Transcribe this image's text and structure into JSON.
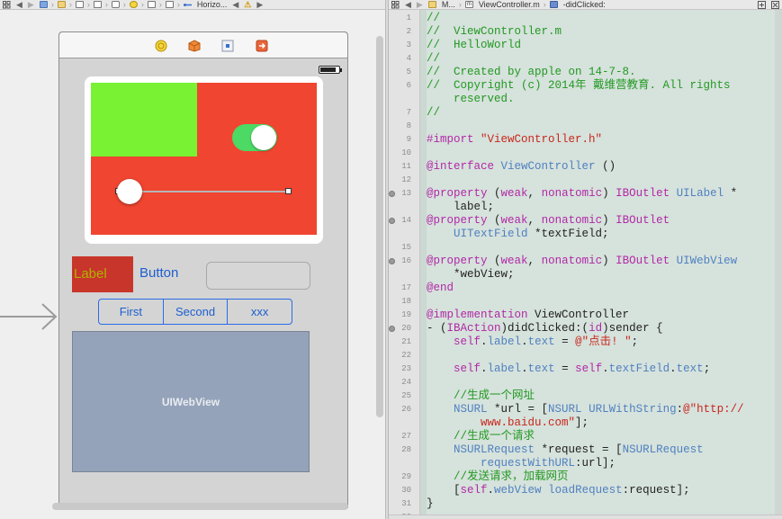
{
  "storyboard": {
    "jumpbar": {
      "nav_back": "◀",
      "nav_forward": "▶",
      "scene_label": "Horizo...",
      "warning_icon": "⚠"
    },
    "dock_icons": [
      "view-controller-icon",
      "first-responder-icon",
      "exit-icon",
      "unwind-icon"
    ],
    "label_text": "Label",
    "button_text": "Button",
    "textfield_value": "",
    "segments": [
      "First",
      "Second",
      "xxx"
    ],
    "webview_text": "UIWebView",
    "switch_on": true,
    "slider_value": 0,
    "colors": {
      "red_view": "#ef4531",
      "green_view": "#78f232",
      "switch_on": "#4cd964",
      "tint": "#1d5fcf",
      "webview": "#94a3b9"
    }
  },
  "editor": {
    "jumpbar": {
      "group": "M...",
      "file": "ViewController.m",
      "method": "-didClicked:",
      "warning_icon": "⚠"
    },
    "colors": {
      "background": "#d6e2dc",
      "comment": "#229922",
      "keyword": "#b128a6",
      "string": "#c8261c",
      "type": "#4f81c0"
    },
    "lines": [
      {
        "n": "1",
        "dot": false,
        "tokens": [
          [
            "c",
            "//"
          ]
        ]
      },
      {
        "n": "2",
        "dot": false,
        "tokens": [
          [
            "c",
            "//  ViewController.m"
          ]
        ]
      },
      {
        "n": "3",
        "dot": false,
        "tokens": [
          [
            "c",
            "//  HelloWorld"
          ]
        ]
      },
      {
        "n": "4",
        "dot": false,
        "tokens": [
          [
            "c",
            "//"
          ]
        ]
      },
      {
        "n": "5",
        "dot": false,
        "tokens": [
          [
            "c",
            "//  Created by apple on 14-7-8."
          ]
        ]
      },
      {
        "n": "6",
        "dot": false,
        "tokens": [
          [
            "c",
            "//  Copyright (c) 2014年 戴维营教育. All rights"
          ]
        ]
      },
      {
        "n": "",
        "dot": false,
        "tokens": [
          [
            "c",
            "    reserved."
          ]
        ]
      },
      {
        "n": "7",
        "dot": false,
        "tokens": [
          [
            "c",
            "//"
          ]
        ]
      },
      {
        "n": "8",
        "dot": false,
        "tokens": []
      },
      {
        "n": "9",
        "dot": false,
        "tokens": [
          [
            "k",
            "#import"
          ],
          [
            "p",
            " "
          ],
          [
            "s",
            "\"ViewController.h\""
          ]
        ]
      },
      {
        "n": "10",
        "dot": false,
        "tokens": []
      },
      {
        "n": "11",
        "dot": false,
        "tokens": [
          [
            "k",
            "@interface"
          ],
          [
            "p",
            " "
          ],
          [
            "t",
            "ViewController"
          ],
          [
            "p",
            " ()"
          ]
        ]
      },
      {
        "n": "12",
        "dot": false,
        "tokens": []
      },
      {
        "n": "13",
        "dot": true,
        "tokens": [
          [
            "k",
            "@property"
          ],
          [
            "p",
            " ("
          ],
          [
            "k",
            "weak"
          ],
          [
            "p",
            ", "
          ],
          [
            "k",
            "nonatomic"
          ],
          [
            "p",
            ") "
          ],
          [
            "k",
            "IBOutlet"
          ],
          [
            "p",
            " "
          ],
          [
            "t",
            "UILabel"
          ],
          [
            "p",
            " *"
          ]
        ]
      },
      {
        "n": "",
        "dot": false,
        "tokens": [
          [
            "p",
            "    label;"
          ]
        ]
      },
      {
        "n": "14",
        "dot": true,
        "tokens": [
          [
            "k",
            "@property"
          ],
          [
            "p",
            " ("
          ],
          [
            "k",
            "weak"
          ],
          [
            "p",
            ", "
          ],
          [
            "k",
            "nonatomic"
          ],
          [
            "p",
            ") "
          ],
          [
            "k",
            "IBOutlet"
          ]
        ]
      },
      {
        "n": "",
        "dot": false,
        "tokens": [
          [
            "p",
            "    "
          ],
          [
            "t",
            "UITextField"
          ],
          [
            "p",
            " *textField;"
          ]
        ]
      },
      {
        "n": "15",
        "dot": false,
        "tokens": []
      },
      {
        "n": "16",
        "dot": true,
        "tokens": [
          [
            "k",
            "@property"
          ],
          [
            "p",
            " ("
          ],
          [
            "k",
            "weak"
          ],
          [
            "p",
            ", "
          ],
          [
            "k",
            "nonatomic"
          ],
          [
            "p",
            ") "
          ],
          [
            "k",
            "IBOutlet"
          ],
          [
            "p",
            " "
          ],
          [
            "t",
            "UIWebView"
          ]
        ]
      },
      {
        "n": "",
        "dot": false,
        "tokens": [
          [
            "p",
            "    *webView;"
          ]
        ]
      },
      {
        "n": "17",
        "dot": false,
        "tokens": [
          [
            "k",
            "@end"
          ]
        ]
      },
      {
        "n": "18",
        "dot": false,
        "tokens": []
      },
      {
        "n": "19",
        "dot": false,
        "tokens": [
          [
            "k",
            "@implementation"
          ],
          [
            "p",
            " ViewController"
          ]
        ]
      },
      {
        "n": "20",
        "dot": true,
        "tokens": [
          [
            "p",
            "- ("
          ],
          [
            "k",
            "IBAction"
          ],
          [
            "p",
            ")didClicked:("
          ],
          [
            "k",
            "id"
          ],
          [
            "p",
            ")sender {"
          ]
        ]
      },
      {
        "n": "21",
        "dot": false,
        "tokens": [
          [
            "p",
            "    "
          ],
          [
            "k",
            "self"
          ],
          [
            "p",
            "."
          ],
          [
            "t",
            "label"
          ],
          [
            "p",
            "."
          ],
          [
            "t",
            "text"
          ],
          [
            "p",
            " = "
          ],
          [
            "s",
            "@\"点击! \""
          ],
          [
            "p",
            ";"
          ]
        ]
      },
      {
        "n": "22",
        "dot": false,
        "tokens": []
      },
      {
        "n": "23",
        "dot": false,
        "tokens": [
          [
            "p",
            "    "
          ],
          [
            "k",
            "self"
          ],
          [
            "p",
            "."
          ],
          [
            "t",
            "label"
          ],
          [
            "p",
            "."
          ],
          [
            "t",
            "text"
          ],
          [
            "p",
            " = "
          ],
          [
            "k",
            "self"
          ],
          [
            "p",
            "."
          ],
          [
            "t",
            "textField"
          ],
          [
            "p",
            "."
          ],
          [
            "t",
            "text"
          ],
          [
            "p",
            ";"
          ]
        ]
      },
      {
        "n": "24",
        "dot": false,
        "tokens": []
      },
      {
        "n": "25",
        "dot": false,
        "tokens": [
          [
            "p",
            "    "
          ],
          [
            "c",
            "//生成一个网址"
          ]
        ]
      },
      {
        "n": "26",
        "dot": false,
        "tokens": [
          [
            "p",
            "    "
          ],
          [
            "t",
            "NSURL"
          ],
          [
            "p",
            " *url = ["
          ],
          [
            "t",
            "NSURL"
          ],
          [
            "p",
            " "
          ],
          [
            "t",
            "URLWithString"
          ],
          [
            "p",
            ":"
          ],
          [
            "s",
            "@\"http://"
          ]
        ]
      },
      {
        "n": "",
        "dot": false,
        "tokens": [
          [
            "p",
            "        "
          ],
          [
            "s",
            "www.baidu.com\""
          ],
          [
            "p",
            "];"
          ]
        ]
      },
      {
        "n": "27",
        "dot": false,
        "tokens": [
          [
            "p",
            "    "
          ],
          [
            "c",
            "//生成一个请求"
          ]
        ]
      },
      {
        "n": "28",
        "dot": false,
        "tokens": [
          [
            "p",
            "    "
          ],
          [
            "t",
            "NSURLRequest"
          ],
          [
            "p",
            " *request = ["
          ],
          [
            "t",
            "NSURLRequest"
          ]
        ]
      },
      {
        "n": "",
        "dot": false,
        "tokens": [
          [
            "p",
            "        "
          ],
          [
            "t",
            "requestWithURL"
          ],
          [
            "p",
            ":url];"
          ]
        ]
      },
      {
        "n": "29",
        "dot": false,
        "tokens": [
          [
            "p",
            "    "
          ],
          [
            "c",
            "//发送请求，加载网页"
          ]
        ]
      },
      {
        "n": "30",
        "dot": false,
        "tokens": [
          [
            "p",
            "    ["
          ],
          [
            "k",
            "self"
          ],
          [
            "p",
            "."
          ],
          [
            "t",
            "webView"
          ],
          [
            "p",
            " "
          ],
          [
            "t",
            "loadRequest"
          ],
          [
            "p",
            ":request];"
          ]
        ]
      },
      {
        "n": "31",
        "dot": false,
        "tokens": [
          [
            "p",
            "}"
          ]
        ]
      },
      {
        "n": "32",
        "dot": false,
        "tokens": []
      }
    ]
  }
}
